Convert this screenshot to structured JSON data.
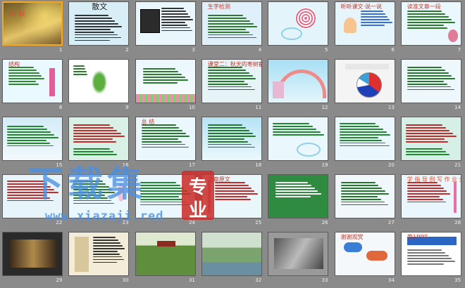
{
  "slide_numbers": [
    "1",
    "2",
    "3",
    "4",
    "5",
    "6",
    "7",
    "8",
    "9",
    "10",
    "11",
    "12",
    "13",
    "14",
    "15",
    "16",
    "17",
    "18",
    "19",
    "20",
    "21",
    "22",
    "23",
    "24",
    "25",
    "26",
    "27",
    "28",
    "29",
    "30",
    "31",
    "32",
    "33",
    "34",
    "35"
  ],
  "selected_slide": "1",
  "slide_texts": {
    "1": "秋 秋",
    "2": "散文",
    "4": "生字检测",
    "6": "听听课文·说一说",
    "7": "读准文章一段",
    "8": "结构",
    "11": "课堂二：秋天的枣树都是什么颜色？",
    "12": "",
    "17": "总 结",
    "25": "文章原文",
    "28": "学 指 导 例 写 作 业 务 ?",
    "34": "谢谢观赏",
    "35": "第1PPT"
  },
  "watermark": {
    "title": "下载集",
    "badge_top": "专",
    "badge_bottom": "业",
    "url": "www.xiazaji.red"
  },
  "colors": {
    "background": "#8a8a8a",
    "selection": "#f5a623",
    "watermark_blue": "#4a8fe0",
    "badge_red": "#c9302c"
  }
}
